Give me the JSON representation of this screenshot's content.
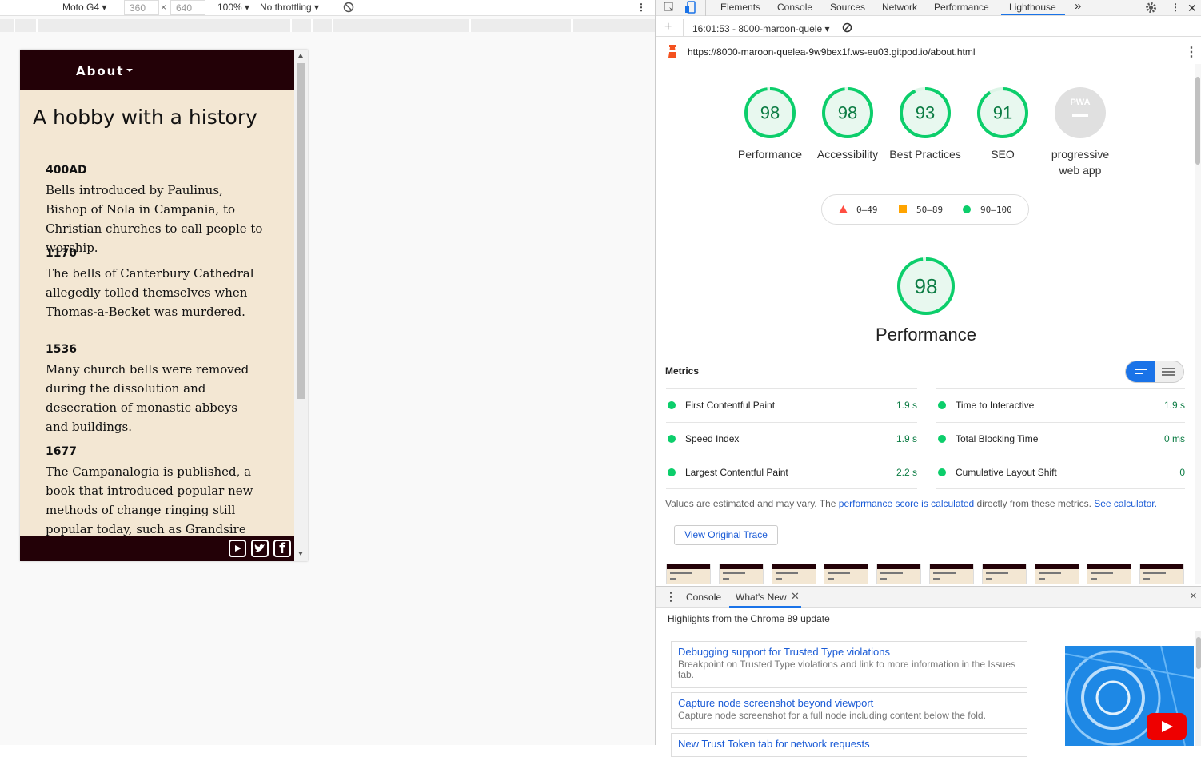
{
  "device_toolbar": {
    "device": "Moto G4",
    "width": "360",
    "times": "×",
    "height": "640",
    "zoom": "100%",
    "throttling": "No throttling"
  },
  "site": {
    "nav_label": "About",
    "title": "A hobby with a history",
    "history": [
      {
        "year": "400AD",
        "text": "Bells introduced by Paulinus, Bishop of Nola in Campania, to Christian churches to call people to worship."
      },
      {
        "year": "1170",
        "text": "The bells of Canterbury Cathedral allegedly tolled themselves when Thomas-a-Becket was murdered."
      },
      {
        "year": "1536",
        "text": "Many church bells were removed during the dissolution and desecration of monastic abbeys and buildings."
      },
      {
        "year": "1677",
        "text": "The Campanalogia is published, a book that introduced popular new methods of change ringing still popular today, such as Grandsire and"
      }
    ],
    "social": [
      "youtube-icon",
      "twitter-icon",
      "facebook-icon"
    ]
  },
  "devtools": {
    "tabs": [
      "Elements",
      "Console",
      "Sources",
      "Network",
      "Performance",
      "Lighthouse"
    ],
    "more": "»",
    "report_time": "16:01:53 - 8000-maroon-quele",
    "url": "https://8000-maroon-quelea-9w9bex1f.ws-eu03.gitpod.io/about.html",
    "colors": {
      "pass": "#0cce6b",
      "pass_text": "#0c7c44",
      "average": "#ffa400",
      "fail": "#ff4e42"
    },
    "gauges": [
      {
        "score": "98",
        "label": "Performance",
        "value": 98
      },
      {
        "score": "98",
        "label": "Accessibility",
        "value": 98
      },
      {
        "score": "93",
        "label": "Best Practices",
        "value": 93
      },
      {
        "score": "91",
        "label": "SEO",
        "value": 91
      }
    ],
    "pwa": {
      "badge": "PWA",
      "label": "progressive web app"
    },
    "legend": {
      "fail": "0–49",
      "average": "50–89",
      "pass": "90–100"
    },
    "perf": {
      "score": "98",
      "value": 98,
      "title": "Performance"
    },
    "metrics_title": "Metrics",
    "metrics": [
      {
        "name": "First Contentful Paint",
        "value": "1.9 s"
      },
      {
        "name": "Time to Interactive",
        "value": "1.9 s"
      },
      {
        "name": "Speed Index",
        "value": "1.9 s"
      },
      {
        "name": "Total Blocking Time",
        "value": "0 ms"
      },
      {
        "name": "Largest Contentful Paint",
        "value": "2.2 s"
      },
      {
        "name": "Cumulative Layout Shift",
        "value": "0"
      }
    ],
    "note_prefix": "Values are estimated and may vary. The ",
    "note_link": "performance score is calculated",
    "note_mid": " directly from these metrics. ",
    "note_calc": "See calculator.",
    "trace_button": "View Original Trace",
    "drawer_tabs": [
      "Console",
      "What's New"
    ],
    "drawer_close": "×",
    "whats_new_heading": "Highlights from the Chrome 89 update",
    "whats_new": [
      {
        "title": "Debugging support for Trusted Type violations",
        "desc": "Breakpoint on Trusted Type violations and link to more information in the Issues tab."
      },
      {
        "title": "Capture node screenshot beyond viewport",
        "desc": "Capture node screenshot for a full node including content below the fold."
      },
      {
        "title": "New Trust Token tab for network requests",
        "desc": ""
      }
    ]
  }
}
